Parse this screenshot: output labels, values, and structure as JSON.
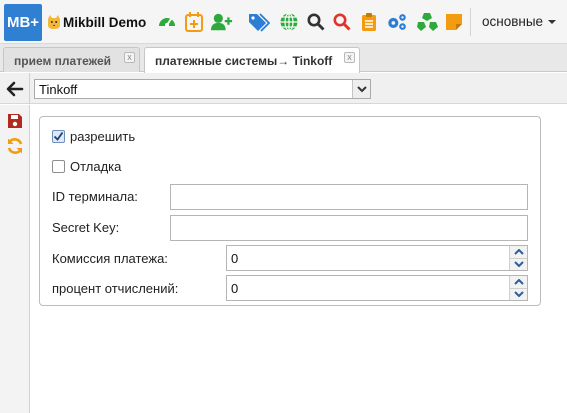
{
  "app": {
    "logo": "MB+",
    "title": "Mikbill Demo",
    "menu_label": "основные"
  },
  "toolbar": {
    "icons": [
      "dashboard-icon",
      "calendar-icon",
      "add-user-icon",
      "tags-icon",
      "globe-icon",
      "search-icon",
      "search-red-icon",
      "clipboard-icon",
      "cogs-icon",
      "cubes-icon",
      "note-icon"
    ]
  },
  "tabs": [
    {
      "label": "прием платежей",
      "active": false,
      "close": "x"
    },
    {
      "label": "платежные системы→ Tinkoff",
      "active": true,
      "close": "x"
    }
  ],
  "selector": {
    "value": "Tinkoff"
  },
  "form": {
    "enable_label": "разрешить",
    "enable_checked": true,
    "debug_label": "Отладка",
    "debug_checked": false,
    "terminal_id_label": "ID терминала:",
    "terminal_id_value": "",
    "secret_key_label": "Secret Key:",
    "secret_key_value": "",
    "commission_label": "Комиссия платежа:",
    "commission_value": "0",
    "deduction_label": "процент отчислений:",
    "deduction_value": "0"
  },
  "colors": {
    "logo_bg": "#2f7fd2",
    "green": "#2eaa3c",
    "orange": "#f39c12",
    "blue": "#2b7dd6",
    "red": "#e0332b",
    "save_red": "#b02a20"
  }
}
